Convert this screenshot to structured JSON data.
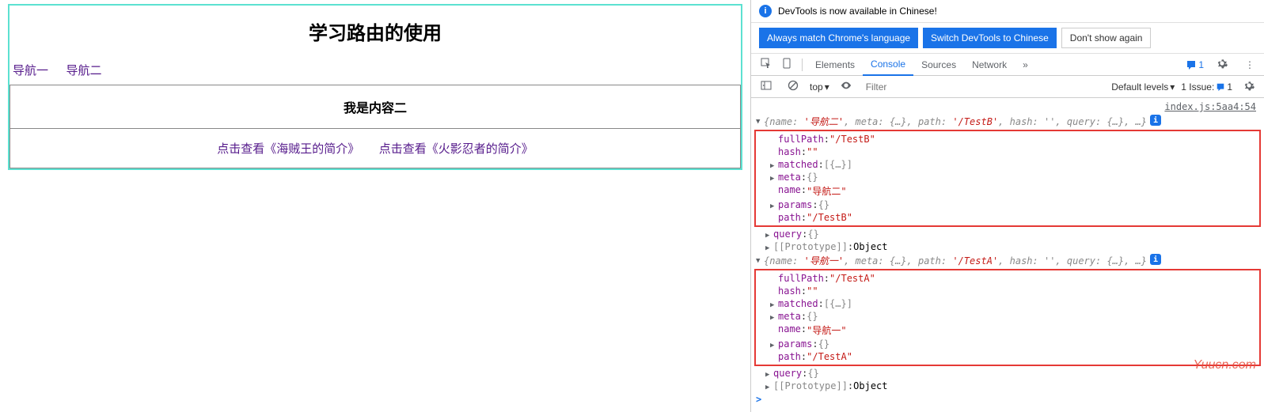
{
  "app": {
    "title": "学习路由的使用",
    "nav": [
      {
        "label": "导航一"
      },
      {
        "label": "导航二"
      }
    ],
    "content": {
      "title": "我是内容二",
      "links": [
        {
          "label": "点击查看《海贼王的简介》"
        },
        {
          "label": "点击查看《火影忍者的简介》"
        }
      ]
    }
  },
  "devtools": {
    "notification": "DevTools is now available in Chinese!",
    "buttons": {
      "always": "Always match Chrome's language",
      "switch": "Switch DevTools to Chinese",
      "dont": "Don't show again"
    },
    "tabs": [
      "Elements",
      "Console",
      "Sources",
      "Network"
    ],
    "activeTab": "Console",
    "more": "»",
    "issueBadge": "1",
    "filter": {
      "context": "top",
      "placeholder": "Filter",
      "levels": "Default levels",
      "issues": "1 Issue:",
      "issuesCount": "1"
    },
    "source": "index.js:5aa4:54",
    "prompt": ">",
    "watermark": "Yuucn.com",
    "objects": [
      {
        "summary": {
          "name": "导航二",
          "path": "/TestB"
        },
        "fullPath": "\"/TestB\"",
        "hash": "\"\"",
        "matched": "[{…}]",
        "meta": "{}",
        "name": "\"导航二\"",
        "params": "{}",
        "pathVal": "\"/TestB\""
      },
      {
        "summary": {
          "name": "导航一",
          "path": "/TestA"
        },
        "fullPath": "\"/TestA\"",
        "hash": "\"\"",
        "matched": "[{…}]",
        "meta": "{}",
        "name": "\"导航一\"",
        "params": "{}",
        "pathVal": "\"/TestA\""
      }
    ],
    "extras": {
      "query": "{}",
      "proto": "[[Prototype]]",
      "protoVal": "Object"
    }
  }
}
